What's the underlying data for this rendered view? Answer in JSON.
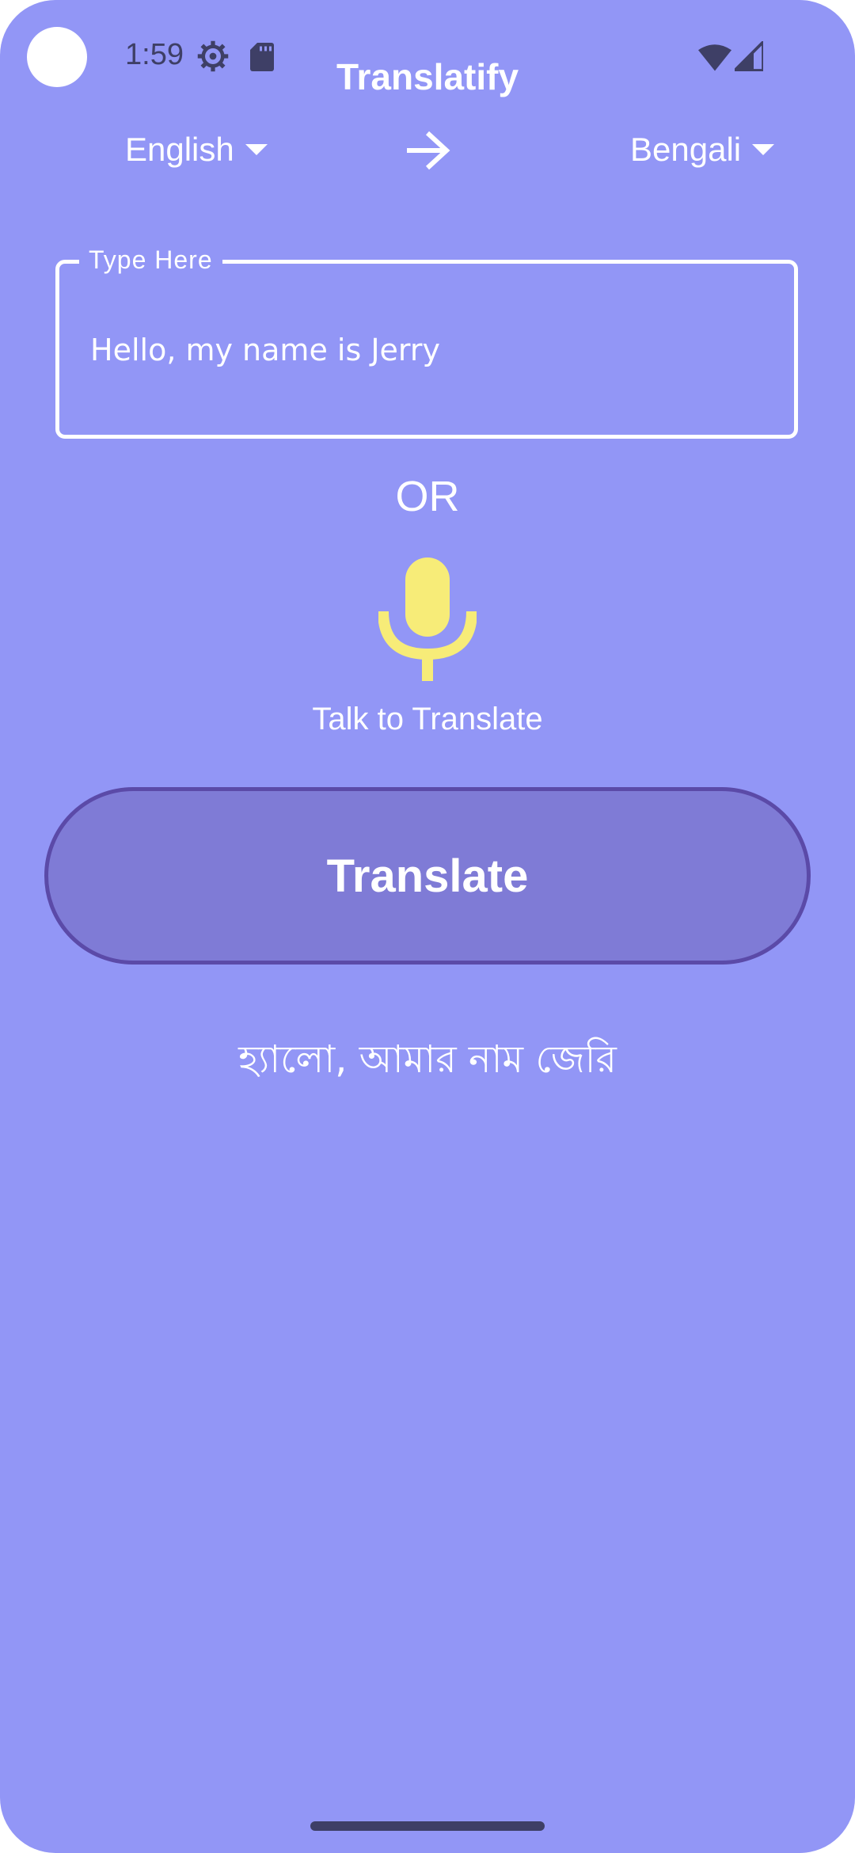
{
  "status_bar": {
    "time": "1:59",
    "icons": [
      "settings-gear-icon",
      "sd-card-icon",
      "wifi-icon",
      "cell-signal-icon"
    ]
  },
  "app": {
    "title": "Translatify"
  },
  "languages": {
    "source": "English",
    "target": "Bengali"
  },
  "input": {
    "label": "Type Here",
    "value": "Hello, my name is Jerry"
  },
  "divider_text": "OR",
  "voice": {
    "label": "Talk to Translate",
    "icon": "microphone-icon"
  },
  "action": {
    "translate_label": "Translate"
  },
  "result": {
    "text": "হ্যালো, আমার নাম জেরি"
  },
  "colors": {
    "background": "#9296f6",
    "button_fill": "#7f7bd6",
    "button_border": "#5b4aa8",
    "mic": "#f7ec78",
    "text": "#ffffff"
  }
}
